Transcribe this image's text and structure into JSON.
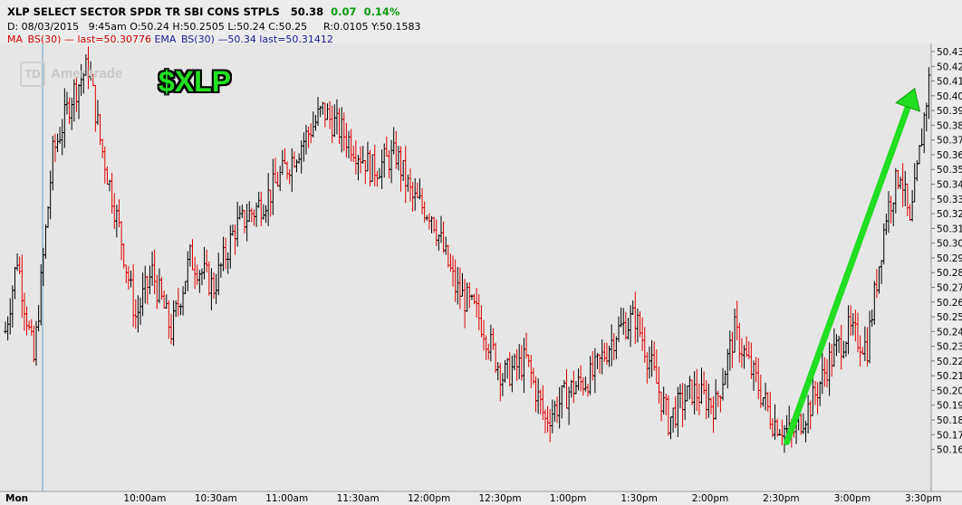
{
  "header": {
    "symbol": "XLP SELECT SECTOR SPDR TR SBI CONS STPLS",
    "last": "50.38",
    "change": "0.07",
    "change_pct": "0.14%",
    "date": "D: 08/03/2015",
    "time": "9:45am",
    "open": "O:50.24",
    "high": "H:50.2505",
    "low": "L:50.24",
    "close": "C:50.25",
    "range": "R:0.0105",
    "yval": "Y:50.1583",
    "ma_label": "MA_BS(30)",
    "ma_last": "last=50.30776",
    "ema_label": "EMA_BS(30)",
    "ema_value": "50.34",
    "ema_last": "last=50.31412"
  },
  "watermark": {
    "logo": "TD",
    "text": "Ameritrade"
  },
  "ticker_label": "$XLP",
  "colors": {
    "up": "#000000",
    "down": "#e00000",
    "arrow": "#22dd22",
    "ma": "#d00000",
    "ema": "#1a1a9a",
    "change": "#0a9a0a"
  },
  "chart_data": {
    "type": "ohlc",
    "y_ticks": [
      "50.16",
      "50.17",
      "50.18",
      "50.19",
      "50.20",
      "50.21",
      "50.22",
      "50.23",
      "50.24",
      "50.25",
      "50.26",
      "50.27",
      "50.28",
      "50.29",
      "50.30",
      "50.31",
      "50.32",
      "50.33",
      "50.34",
      "50.35",
      "50.36",
      "50.37",
      "50.38",
      "50.39",
      "50.40",
      "50.41",
      "50.42",
      "50.43"
    ],
    "ylim": [
      50.16,
      50.43
    ],
    "x_tick_labels": [
      "Mon",
      "10:00am",
      "10:30am",
      "11:00am",
      "11:30am",
      "12:00pm",
      "12:30pm",
      "1:00pm",
      "1:30pm",
      "2:00pm",
      "2:30pm",
      "3:00pm",
      "3:30pm"
    ],
    "x_tick_minutes": [
      0,
      30,
      60,
      90,
      120,
      150,
      180,
      210,
      240,
      270,
      300,
      330,
      360
    ],
    "session_minutes": 390,
    "key_closes": [
      {
        "t": 0,
        "v": 50.24
      },
      {
        "t": 5,
        "v": 50.29
      },
      {
        "t": 12,
        "v": 50.22
      },
      {
        "t": 20,
        "v": 50.36
      },
      {
        "t": 28,
        "v": 50.4
      },
      {
        "t": 35,
        "v": 50.42
      },
      {
        "t": 40,
        "v": 50.37
      },
      {
        "t": 48,
        "v": 50.31
      },
      {
        "t": 55,
        "v": 50.25
      },
      {
        "t": 62,
        "v": 50.28
      },
      {
        "t": 70,
        "v": 50.24
      },
      {
        "t": 78,
        "v": 50.29
      },
      {
        "t": 88,
        "v": 50.27
      },
      {
        "t": 97,
        "v": 50.31
      },
      {
        "t": 110,
        "v": 50.33
      },
      {
        "t": 122,
        "v": 50.36
      },
      {
        "t": 134,
        "v": 50.39
      },
      {
        "t": 145,
        "v": 50.37
      },
      {
        "t": 155,
        "v": 50.35
      },
      {
        "t": 165,
        "v": 50.36
      },
      {
        "t": 172,
        "v": 50.33
      },
      {
        "t": 180,
        "v": 50.32
      },
      {
        "t": 190,
        "v": 50.27
      },
      {
        "t": 200,
        "v": 50.25
      },
      {
        "t": 210,
        "v": 50.21
      },
      {
        "t": 220,
        "v": 50.22
      },
      {
        "t": 228,
        "v": 50.18
      },
      {
        "t": 238,
        "v": 50.2
      },
      {
        "t": 248,
        "v": 50.21
      },
      {
        "t": 258,
        "v": 50.24
      },
      {
        "t": 266,
        "v": 50.25
      },
      {
        "t": 272,
        "v": 50.22
      },
      {
        "t": 280,
        "v": 50.18
      },
      {
        "t": 290,
        "v": 50.2
      },
      {
        "t": 300,
        "v": 50.19
      },
      {
        "t": 308,
        "v": 50.24
      },
      {
        "t": 316,
        "v": 50.21
      },
      {
        "t": 324,
        "v": 50.18
      },
      {
        "t": 332,
        "v": 50.17
      },
      {
        "t": 340,
        "v": 50.19
      },
      {
        "t": 348,
        "v": 50.22
      },
      {
        "t": 356,
        "v": 50.24
      },
      {
        "t": 364,
        "v": 50.23
      },
      {
        "t": 372,
        "v": 50.32
      },
      {
        "t": 378,
        "v": 50.35
      },
      {
        "t": 382,
        "v": 50.31
      },
      {
        "t": 386,
        "v": 50.36
      },
      {
        "t": 390,
        "v": 50.41
      }
    ],
    "arrow": {
      "from": {
        "t": 330,
        "v": 50.165
      },
      "to": {
        "t": 384,
        "v": 50.405
      }
    }
  }
}
